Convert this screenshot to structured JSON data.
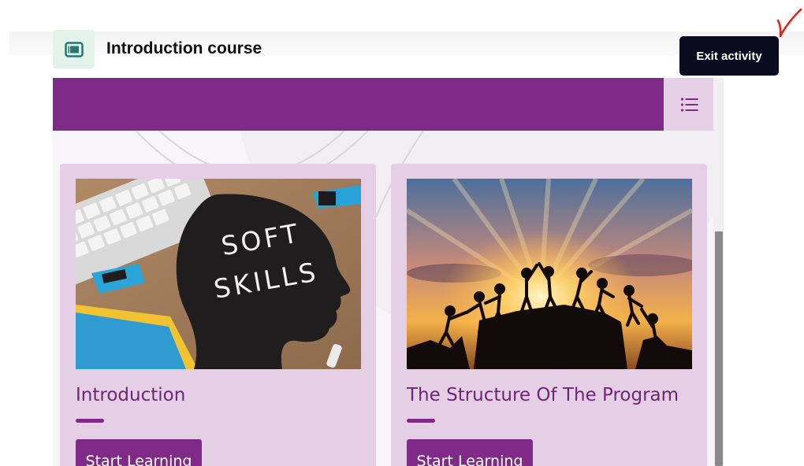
{
  "header": {
    "title": "Introduction course",
    "icon": "slides-icon",
    "exit_label": "Exit activity"
  },
  "activity": {
    "menu_icon": "list-icon",
    "cards": [
      {
        "title": "Introduction",
        "button_label": "Start Learning",
        "image_text": "SOFT SKILLS"
      },
      {
        "title": "The Structure Of The Program",
        "button_label": "Start Learning"
      }
    ]
  },
  "colors": {
    "accent_purple": "#7f2a86",
    "card_background": "#e5cfe5",
    "exit_button": "#0b0b1f"
  }
}
